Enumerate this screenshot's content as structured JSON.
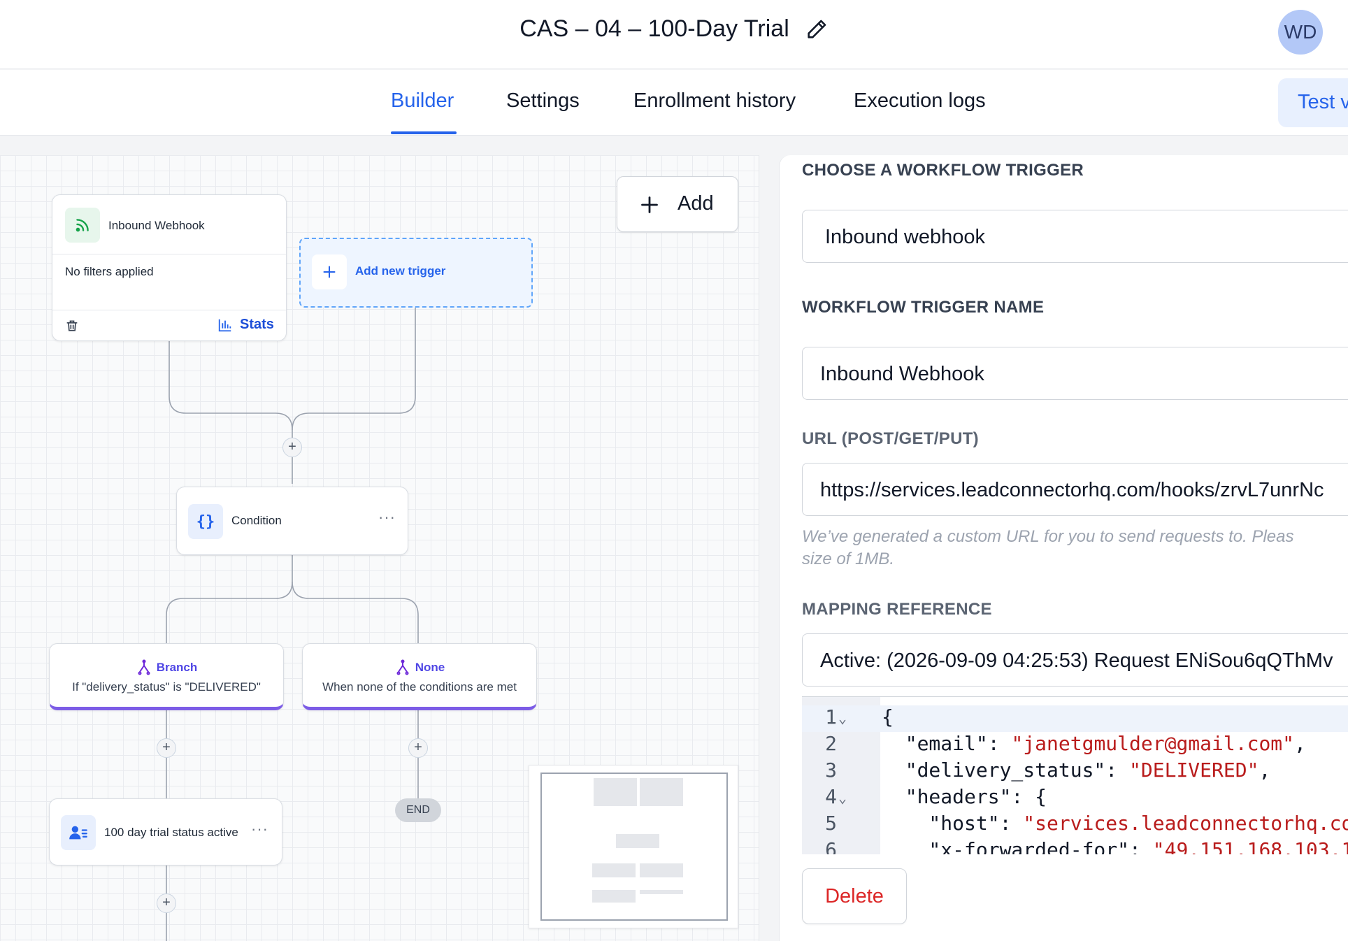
{
  "header": {
    "title": "CAS – 04 – 100-Day Trial",
    "avatar_initials": "WD"
  },
  "tabs": [
    {
      "label": "Builder",
      "active": true
    },
    {
      "label": "Settings",
      "active": false
    },
    {
      "label": "Enrollment history",
      "active": false
    },
    {
      "label": "Execution logs",
      "active": false
    }
  ],
  "test_button": {
    "label": "Test v"
  },
  "canvas": {
    "add_button_label": "Add",
    "trigger_node": {
      "title": "Inbound Webhook",
      "filters_text": "No filters applied",
      "stats_label": "Stats",
      "icon": "rss-icon"
    },
    "add_trigger_label": "Add new trigger",
    "condition_node": {
      "title": "Condition",
      "icon": "braces-icon"
    },
    "branches": [
      {
        "title": "Branch",
        "subtitle": "If \"delivery_status\" is \"DELIVERED\""
      },
      {
        "title": "None",
        "subtitle": "When none of the conditions are met"
      }
    ],
    "action_node": {
      "title": "100 day trial status active",
      "icon": "user-list-icon"
    },
    "end_label": "END"
  },
  "panel": {
    "trigger_section_label": "CHOOSE A WORKFLOW TRIGGER",
    "trigger_value": "Inbound webhook",
    "name_section_label": "WORKFLOW TRIGGER NAME",
    "name_value": "Inbound Webhook",
    "url_section_label": "URL (POST/GET/PUT)",
    "url_value": "https://services.leadconnectorhq.com/hooks/zrvL7unrNc",
    "help_line1": "We’ve generated a custom URL for you to send requests to. Pleas",
    "help_line2": "size of 1MB.",
    "mapping_section_label": "MAPPING REFERENCE",
    "mapping_value": "Active: (2026-09-09 04:25:53) Request ENiSou6qQThMv",
    "code": {
      "line_numbers": [
        "1",
        "2",
        "3",
        "4",
        "5",
        "6"
      ],
      "l1": "{",
      "l2_key": "  \"email\": ",
      "l2_val": "\"janetgmulder@gmail.com\"",
      "l2_end": ",",
      "l3_key": "  \"delivery_status\": ",
      "l3_val": "\"DELIVERED\"",
      "l3_end": ",",
      "l4": "  \"headers\": {",
      "l5_key": "    \"host\": ",
      "l5_val": "\"services.leadconnectorhq.co",
      "l6_key": "    \"x-forwarded-for\": ",
      "l6_val": "\"49.151.168.103.1"
    },
    "delete_label": "Delete"
  },
  "colors": {
    "accent": "#2563eb",
    "branch": "#7c5ce6",
    "danger": "#dc2626",
    "string": "#b91c1c"
  }
}
